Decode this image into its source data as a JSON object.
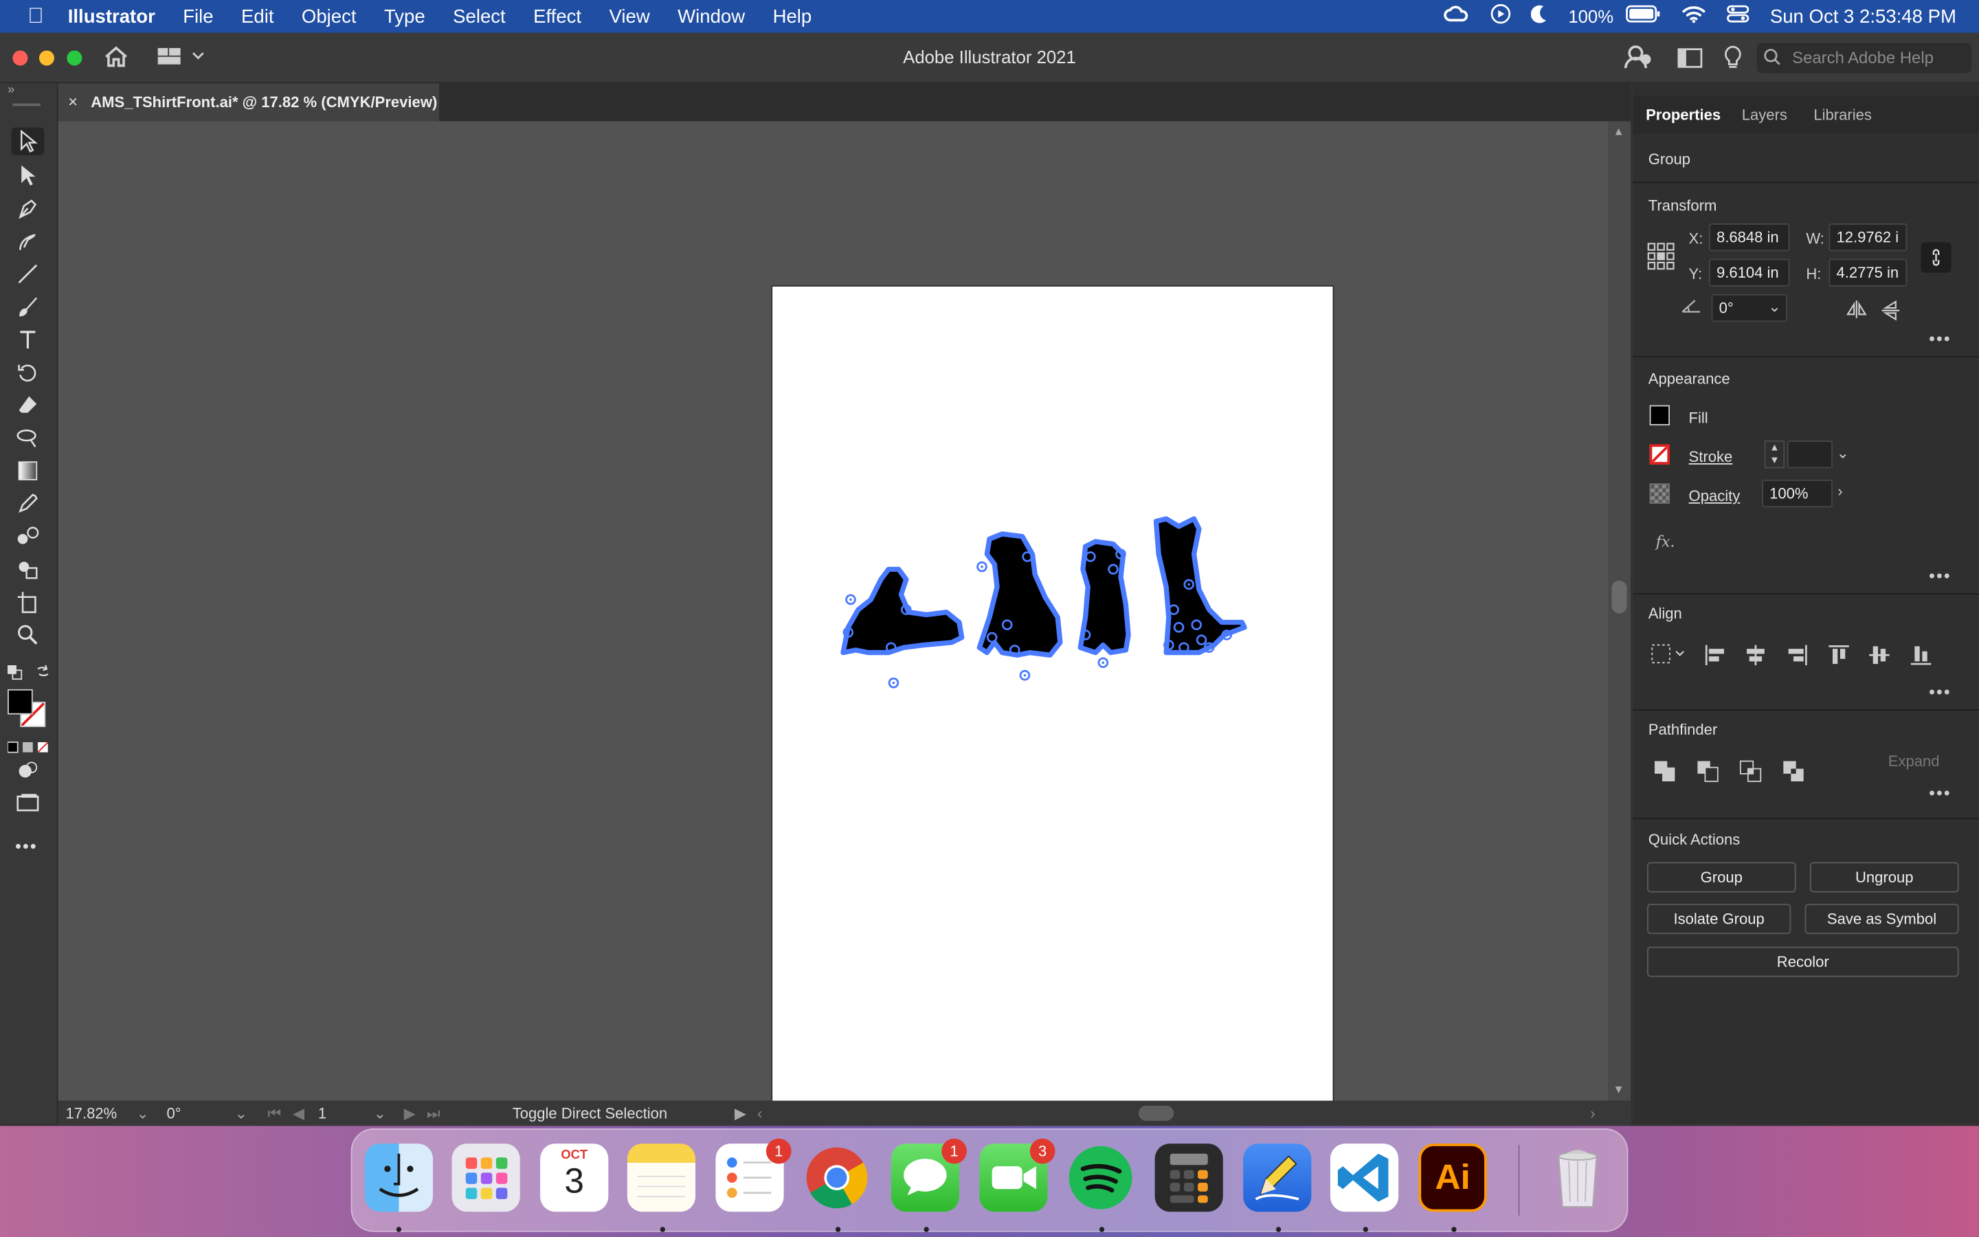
{
  "menubar": {
    "app": "Illustrator",
    "items": [
      "File",
      "Edit",
      "Object",
      "Type",
      "Select",
      "Effect",
      "View",
      "Window",
      "Help"
    ],
    "battery": "100%",
    "datetime": "Sun Oct 3  2:53:48 PM"
  },
  "window": {
    "title": "Adobe Illustrator 2021",
    "search_placeholder": "Search Adobe Help"
  },
  "document": {
    "tab_title": "AMS_TShirtFront.ai* @ 17.82 % (CMYK/Preview)",
    "close_glyph": "×"
  },
  "statusbar": {
    "zoom": "17.82%",
    "rotation": "0°",
    "artboard": "1",
    "tool_hint": "Toggle Direct Selection"
  },
  "panel": {
    "tabs": [
      "Properties",
      "Layers",
      "Libraries"
    ],
    "selection_type": "Group",
    "transform": {
      "heading": "Transform",
      "x_label": "X:",
      "x": "8.6848 in",
      "y_label": "Y:",
      "y": "9.6104 in",
      "w_label": "W:",
      "w": "12.9762 i",
      "h_label": "H:",
      "h": "4.2775 in",
      "angle": "0°"
    },
    "appearance": {
      "heading": "Appearance",
      "fill": "Fill",
      "stroke": "Stroke",
      "opacity_label": "Opacity",
      "opacity": "100%",
      "fx": "fx."
    },
    "align": {
      "heading": "Align"
    },
    "pathfinder": {
      "heading": "Pathfinder",
      "expand": "Expand"
    },
    "quick_actions": {
      "heading": "Quick Actions",
      "group": "Group",
      "ungroup": "Ungroup",
      "isolate": "Isolate Group",
      "save_symbol": "Save as Symbol",
      "recolor": "Recolor"
    }
  },
  "dock": {
    "calendar_month": "OCT",
    "calendar_day": "3",
    "reminders_badge": "1",
    "messages_badge": "1",
    "facetime_badge": "3",
    "illustrator_label": "Ai"
  },
  "colors": {
    "menubar": "#1f4ea3",
    "selection": "#4a7bff",
    "canvas": "#535353",
    "panel": "#2f2f2f"
  }
}
